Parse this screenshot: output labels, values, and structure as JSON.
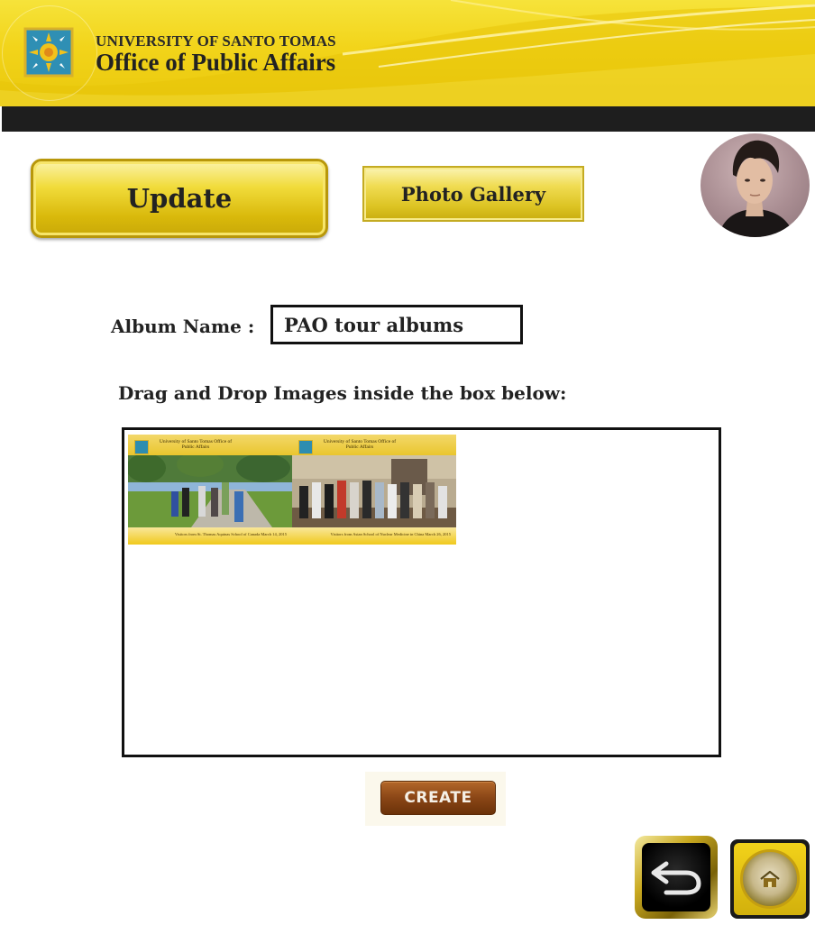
{
  "header": {
    "university": "UNIVERSITY OF SANTO TOMAS",
    "office": "Office of Public Affairs"
  },
  "nav": {
    "update_label": "Update",
    "gallery_label": "Photo Gallery"
  },
  "form": {
    "album_label": "Album Name :",
    "album_value": "PAO tour albums",
    "instruction": "Drag and Drop Images inside the box below:"
  },
  "thumbnails": [
    {
      "header": "University of Santo Tomas Office of Public Affairs",
      "caption": "Visitors from St. Thomas Aquinas School of Canada March 14, 2015"
    },
    {
      "header": "University of Santo Tomas Office of Public Affairs",
      "caption": "Visitors from Asian School of Nuclear Medicine in China March 26, 2015"
    }
  ],
  "actions": {
    "create_label": "CREATE"
  },
  "icons": {
    "back": "back-arrow-icon",
    "home": "home-icon"
  },
  "colors": {
    "brand_yellow": "#f2d41a",
    "bar_black": "#1e1e1e",
    "create_brown": "#8a4616"
  }
}
